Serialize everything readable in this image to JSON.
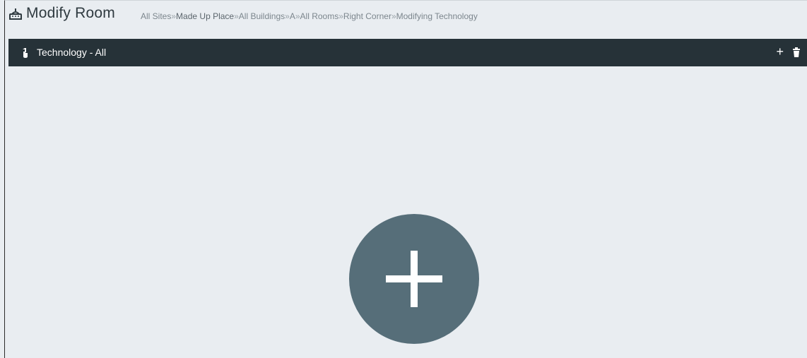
{
  "header": {
    "title": "Modify Room",
    "title_icon": "room-icon"
  },
  "breadcrumb": {
    "items": [
      "All Sites",
      "Made Up Place",
      "All Buildings",
      "A",
      "All Rooms",
      "Right Corner",
      "Modifying Technology"
    ],
    "separator": "»"
  },
  "panel": {
    "title": "Technology - All",
    "icon": "technology-icon",
    "actions": {
      "add_label": "+",
      "delete_icon": "trash-icon"
    }
  },
  "add_button": {
    "icon": "plus-icon"
  },
  "colors": {
    "background": "#e9edf1",
    "panel_bar": "#263238",
    "fab": "#566e79",
    "title": "#2f3a40",
    "breadcrumb": "#7c868d"
  }
}
